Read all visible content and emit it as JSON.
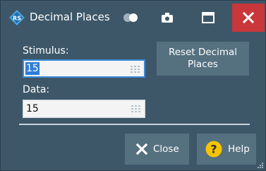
{
  "window": {
    "title": "Decimal Places",
    "app_icon": "rs-logo-icon",
    "controls": [
      "toggle-icon",
      "camera-icon",
      "maximize-icon",
      "close-icon"
    ],
    "accent_color": "#3d5769",
    "close_color": "#c9373a"
  },
  "form": {
    "stimulus_label": "Stimulus:",
    "stimulus_value": "15",
    "data_label": "Data:",
    "data_value": "15",
    "reset_button": "Reset Decimal Places"
  },
  "footer": {
    "close_label": "Close",
    "help_label": "Help",
    "help_icon": "question-icon",
    "help_color": "#f5c400"
  }
}
